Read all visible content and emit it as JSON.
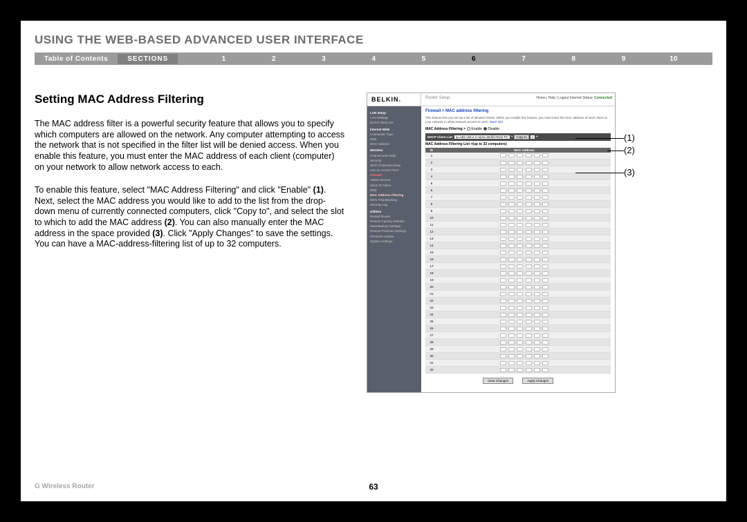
{
  "header": {
    "chapter_title": "USING THE WEB-BASED ADVANCED USER INTERFACE",
    "toc_label": "Table of Contents",
    "sections_label": "SECTIONS",
    "section_numbers": [
      "1",
      "2",
      "3",
      "4",
      "5",
      "6",
      "7",
      "8",
      "9",
      "10"
    ],
    "active_section": "6"
  },
  "content": {
    "heading": "Setting MAC Address Filtering",
    "para1": "The MAC address filter is a powerful security feature that allows you to specify which computers are allowed on the network. Any computer attempting to access the network that is not specified in the filter list will be denied access. When you enable this feature, you must enter the MAC address of each client (computer) on your network to allow network access to each.",
    "para2_a": "To enable this feature, select \"MAC Address Filtering\" and click \"Enable\" ",
    "para2_b": "(1)",
    "para2_c": ". Next, select the MAC address you would like to add to the list from the drop-down menu of currently connected computers, click \"Copy to\", and select the slot to which to add the MAC address ",
    "para2_d": "(2)",
    "para2_e": ". You can also manually enter the MAC address in the space provided ",
    "para2_f": "(3)",
    "para2_g": ". Click \"Apply Changes\" to save the settings. You can have a MAC-address-filtering list of up to 32 computers."
  },
  "screenshot": {
    "brand": "BELKIN.",
    "router_setup": "Router Setup",
    "status_prefix": "Home | Help | Logout   Internet Status: ",
    "status_value": "Connected",
    "sidebar": [
      {
        "t": "LAN Setup",
        "c": "cat"
      },
      {
        "t": "LAN Settings"
      },
      {
        "t": "DHCP Client List"
      },
      {
        "t": "Internet WAN",
        "c": "cat"
      },
      {
        "t": "Connection Type"
      },
      {
        "t": "DNS"
      },
      {
        "t": "MAC Address"
      },
      {
        "t": "Wireless",
        "c": "cat"
      },
      {
        "t": "Channel and SSID"
      },
      {
        "t": "Security"
      },
      {
        "t": "Wi-Fi Protected Setup"
      },
      {
        "t": "Use as Access Point"
      },
      {
        "t": "Firewall",
        "c": "fire"
      },
      {
        "t": "Virtual Servers"
      },
      {
        "t": "Client IP Filters"
      },
      {
        "t": "DMZ"
      },
      {
        "t": "MAC Address Filtering",
        "c": "active"
      },
      {
        "t": "WAN Ping Blocking"
      },
      {
        "t": "Security Log"
      },
      {
        "t": "Utilities",
        "c": "cat"
      },
      {
        "t": "Restart Router"
      },
      {
        "t": "Restore Factory Defaults"
      },
      {
        "t": "Save/Backup Settings"
      },
      {
        "t": "Restore Previous Settings"
      },
      {
        "t": "Firmware Update"
      },
      {
        "t": "System Settings"
      }
    ],
    "breadcrumb": "Firewall > MAC address filtering",
    "desc": "This feature lets you set up a list of allowed clients. When you enable this feature, you must enter the MAC address of each client on your network to allow network access to each. ",
    "more_info": "More Info",
    "enable_label": "MAC Address Filtering >",
    "enable_opt": "Enable",
    "disable_opt": "Disable",
    "dhcp_label": "DHCP Client List:",
    "dhcp_value": "ip=192.168.2.2 name=BelkinTest2-PC",
    "copy_to": "Copy to",
    "copy_slot": "1",
    "list_label": "MAC Address Filtering List >(up to 32 computers)",
    "th_id": "ID",
    "th_mac": "MAC Address",
    "row_count": 32,
    "clear_changes": "Clear Changes",
    "apply_changes": "Apply Changes"
  },
  "callouts": {
    "c1": "(1)",
    "c2": "(2)",
    "c3": "(3)"
  },
  "footer": {
    "product": "G Wireless Router",
    "page": "63"
  }
}
